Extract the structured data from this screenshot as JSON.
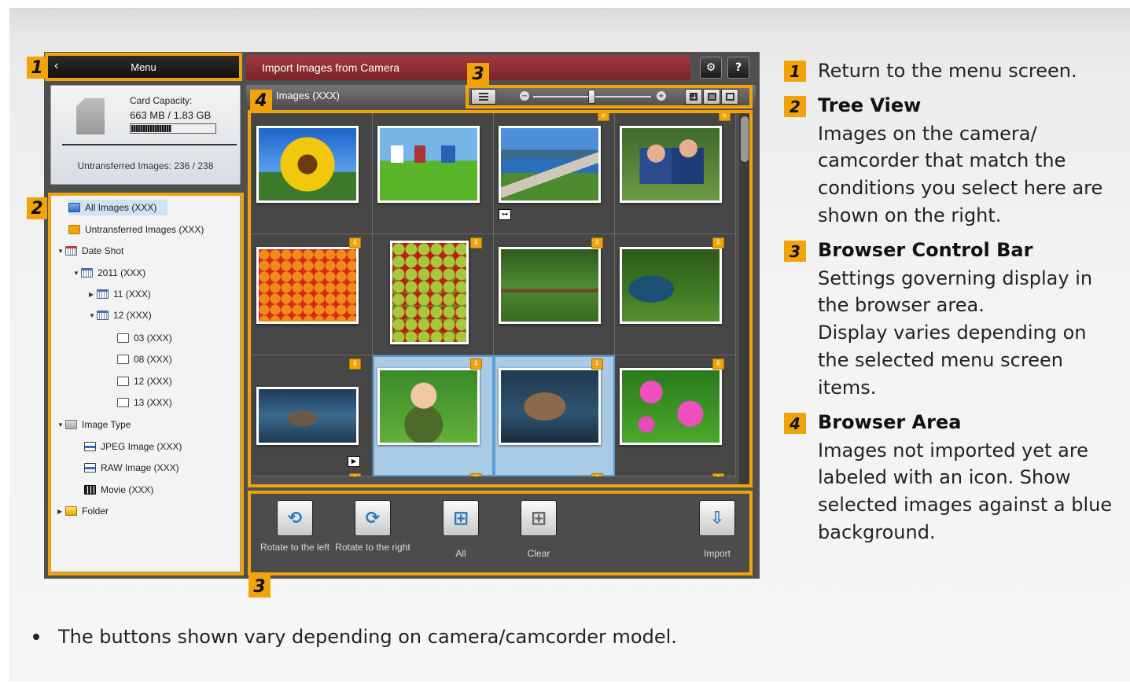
{
  "app": {
    "menu_label": "Menu",
    "window_title": "Import Images from Camera",
    "settings_icon": "gear-icon",
    "help_label": "?",
    "card": {
      "capacity_label": "Card Capacity:",
      "capacity_value": "663 MB / 1.83 GB",
      "untransferred": "Untransferred Images: 236 / 238"
    },
    "tree": [
      {
        "label": "All Images (XXX)",
        "icon": "all-images-icon",
        "selected": true
      },
      {
        "label": "Untransferred Images (XXX)",
        "icon": "untransferred-icon"
      },
      {
        "label": "Date Shot",
        "icon": "calendar-icon",
        "expanded": true
      },
      {
        "label": "2011 (XXX)",
        "icon": "calendar-icon",
        "expanded": true
      },
      {
        "label": "11 (XXX)",
        "icon": "calendar-icon",
        "expanded": false
      },
      {
        "label": "12 (XXX)",
        "icon": "calendar-icon",
        "expanded": true
      },
      {
        "label": "03 (XXX)",
        "icon": "day-icon"
      },
      {
        "label": "08 (XXX)",
        "icon": "day-icon"
      },
      {
        "label": "12 (XXX)",
        "icon": "day-icon"
      },
      {
        "label": "13 (XXX)",
        "icon": "day-icon"
      },
      {
        "label": "Image Type",
        "icon": "image-type-icon",
        "expanded": true
      },
      {
        "label": "JPEG Image (XXX)",
        "icon": "jpeg-icon"
      },
      {
        "label": "RAW Image (XXX)",
        "icon": "raw-icon"
      },
      {
        "label": "Movie (XXX)",
        "icon": "movie-icon"
      },
      {
        "label": "Folder",
        "icon": "folder-icon",
        "expanded": false
      }
    ],
    "browser": {
      "title": "Images (XXX)",
      "zoom_minus": "−",
      "zoom_plus": "+"
    },
    "thumbnails": [
      {
        "subject": "sunflower",
        "new": false,
        "selected": false
      },
      {
        "subject": "laundry-line",
        "new": false,
        "selected": false
      },
      {
        "subject": "lake-road",
        "new": true,
        "selected": false,
        "badge": "protect-key-icon"
      },
      {
        "subject": "couple-portrait",
        "new": true,
        "selected": false
      },
      {
        "subject": "fruit-market",
        "new": true,
        "selected": false
      },
      {
        "subject": "apples-tomatoes",
        "new": true,
        "selected": false
      },
      {
        "subject": "park-bench",
        "new": true,
        "selected": false
      },
      {
        "subject": "child-by-river",
        "new": true,
        "selected": false
      },
      {
        "subject": "duck-in-water",
        "new": true,
        "selected": false,
        "badge": "movie-icon"
      },
      {
        "subject": "baby-on-grass",
        "new": true,
        "selected": true
      },
      {
        "subject": "cat",
        "new": true,
        "selected": true
      },
      {
        "subject": "pink-flowers",
        "new": true,
        "selected": false
      }
    ],
    "actions": [
      {
        "label": "Rotate to the left",
        "icon": "rotate-left-icon"
      },
      {
        "label": "Rotate to the right",
        "icon": "rotate-right-icon"
      },
      {
        "label": "All",
        "icon": "select-all-icon"
      },
      {
        "label": "Clear",
        "icon": "clear-selection-icon"
      },
      {
        "label": "Import",
        "icon": "import-icon"
      }
    ]
  },
  "callouts": [
    "1",
    "2",
    "3",
    "4",
    "3"
  ],
  "legend": [
    {
      "num": "1",
      "text": "Return to the menu screen."
    },
    {
      "num": "2",
      "heading": "Tree View",
      "lines": [
        "Images on the camera/",
        "camcorder that match the",
        "conditions you select here are",
        "shown on the right."
      ]
    },
    {
      "num": "3",
      "heading": "Browser Control Bar",
      "lines": [
        "Settings governing display in",
        "the browser area.",
        "Display varies depending on",
        "the selected menu screen",
        "items."
      ]
    },
    {
      "num": "4",
      "heading": "Browser Area",
      "lines": [
        "Images not imported yet are",
        "labeled with an icon. Show",
        "selected images against a blue",
        "background."
      ]
    }
  ],
  "note": "The buttons shown vary depending on camera/camcorder model.",
  "colors": {
    "accent": "#f0a30a",
    "title_bar": "#8b2c30",
    "selection": "#a9cbe6"
  }
}
